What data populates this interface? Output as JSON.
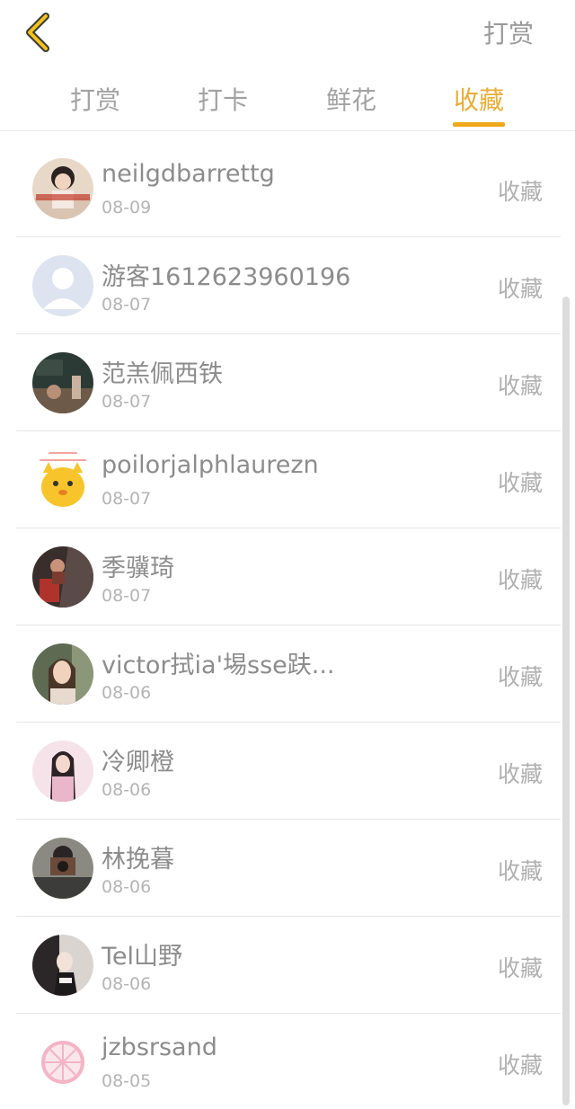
{
  "header": {
    "action_label": "打赏"
  },
  "tabs": [
    {
      "label": "打赏",
      "active": false
    },
    {
      "label": "打卡",
      "active": false
    },
    {
      "label": "鲜花",
      "active": false
    },
    {
      "label": "收藏",
      "active": true
    }
  ],
  "list": [
    {
      "name": "neilgdbarrettg",
      "date": "08-09",
      "action": "收藏",
      "avatar": "photo-woman"
    },
    {
      "name": "游客1612623960196",
      "date": "08-07",
      "action": "收藏",
      "avatar": "default-user"
    },
    {
      "name": "范羔佩西铁",
      "date": "08-07",
      "action": "收藏",
      "avatar": "photo-dark-scene"
    },
    {
      "name": "poilorjalphlaurezn",
      "date": "08-07",
      "action": "收藏",
      "avatar": "cartoon-cat"
    },
    {
      "name": "季骥琦",
      "date": "08-07",
      "action": "收藏",
      "avatar": "photo-dancer"
    },
    {
      "name": "victor拭ia'埸sse趺...",
      "date": "08-06",
      "action": "收藏",
      "avatar": "photo-woman-2"
    },
    {
      "name": "冷卿橙",
      "date": "08-06",
      "action": "收藏",
      "avatar": "photo-girl-pink"
    },
    {
      "name": "林挽暮",
      "date": "08-06",
      "action": "收藏",
      "avatar": "photo-man-camera"
    },
    {
      "name": "Tel山野",
      "date": "08-06",
      "action": "收藏",
      "avatar": "photo-anime"
    },
    {
      "name": "jzbsrsand",
      "date": "08-05",
      "action": "收藏",
      "avatar": "lemon-slice"
    }
  ],
  "colors": {
    "accent": "#f0a91b",
    "text_muted": "#999999"
  }
}
